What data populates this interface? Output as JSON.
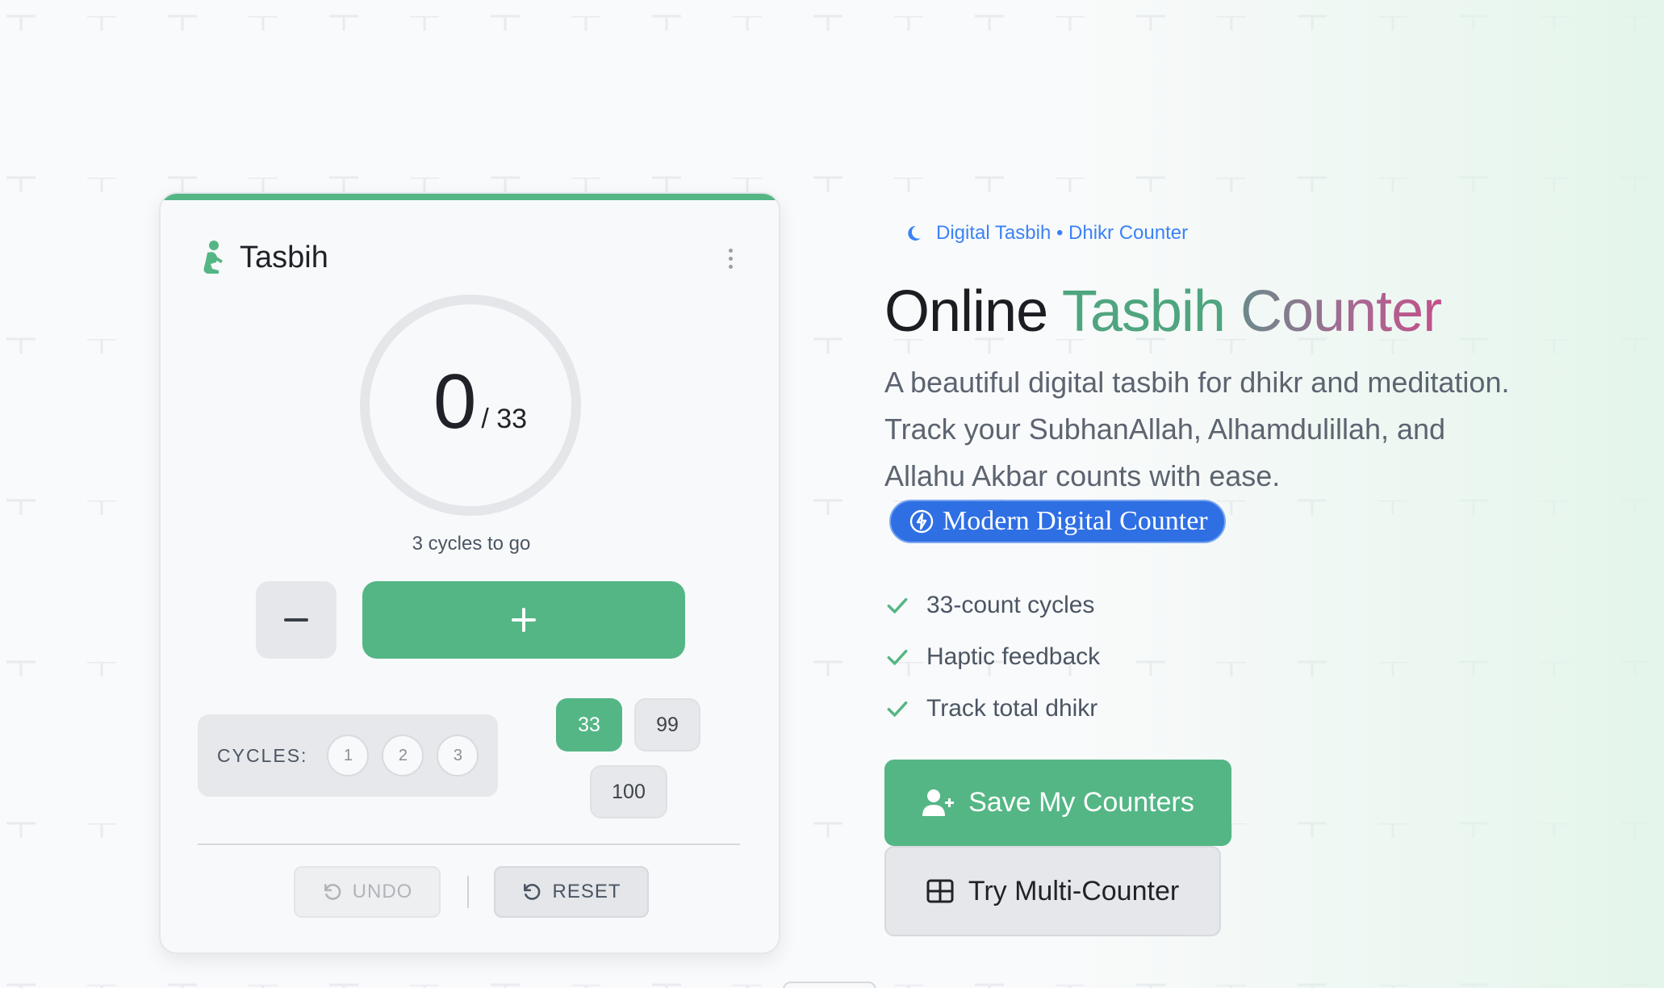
{
  "counter": {
    "title": "Tasbih",
    "count": "0",
    "target": "/ 33",
    "cycles_to_go": "3 cycles to go",
    "cycles_label": "CYCLES:",
    "cycles": [
      "1",
      "2",
      "3"
    ],
    "targets": [
      "33",
      "99",
      "100"
    ],
    "selected_target": "33",
    "undo_label": "UNDO",
    "reset_label": "RESET"
  },
  "hero": {
    "eyebrow": "Digital Tasbih • Dhikr Counter",
    "title_part1": "Online ",
    "title_part2": "Tasbih ",
    "title_part3": "Counter",
    "description": "A beautiful digital tasbih for dhikr and meditation. Track your SubhanAllah, Alhamdulillah, and Allahu Akbar counts with ease.",
    "badge": "Modern Digital Counter",
    "features": [
      "33-count cycles",
      "Haptic feedback",
      "Track total dhikr"
    ],
    "save_button": "Save My Counters",
    "multi_button": "Try Multi-Counter"
  },
  "colors": {
    "accent_green": "#54b685",
    "badge_blue": "#2f6fe4",
    "eyebrow_blue": "#3b82f6"
  }
}
